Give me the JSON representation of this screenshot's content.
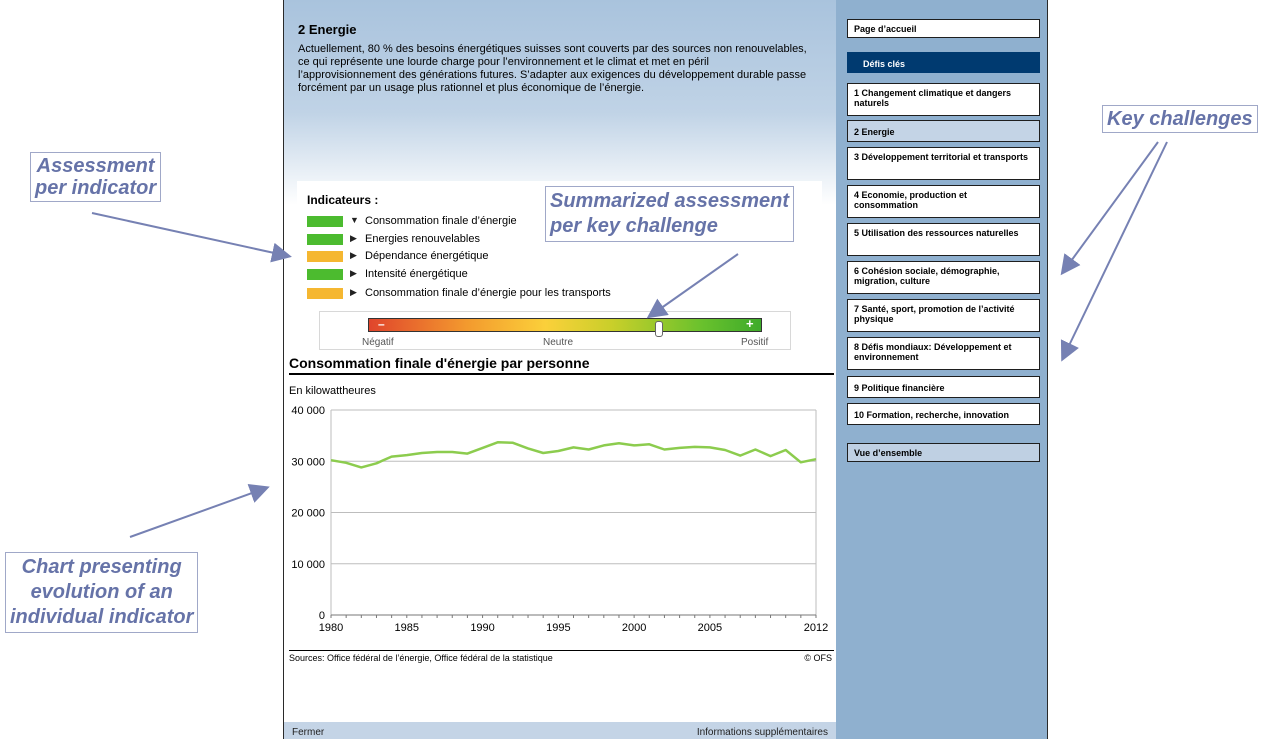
{
  "main": {
    "title": "2 Energie",
    "description": "Actuellement, 80 % des besoins énergétiques suisses sont couverts par des sources non renouvelables, ce qui représente une lourde charge pour l’environnement et le climat et met en péril l’approvisionnement des générations futures. S’adapter aux exigences du développement durable passe forcément par un usage plus rationnel et plus économique de l’énergie.",
    "indicators_title": "Indicateurs :",
    "indicators": [
      {
        "label": "Consommation finale d’énergie",
        "color": "#4cbb2f",
        "arrow": "▼"
      },
      {
        "label": "Energies renouvelables",
        "color": "#4cbb2f",
        "arrow": "▶"
      },
      {
        "label": "Dépendance énergétique",
        "color": "#f5b731",
        "arrow": "▶"
      },
      {
        "label": "Intensité énergétique",
        "color": "#4cbb2f",
        "arrow": "▶"
      },
      {
        "label": "Consommation finale d’énergie pour les transports",
        "color": "#f5b731",
        "arrow": "▶"
      }
    ],
    "scale": {
      "minus": "–",
      "plus": "+",
      "left_label": "Négatif",
      "middle_label": "Neutre",
      "right_label": "Positif",
      "marker_fraction": 0.74
    },
    "chart_title": "Consommation finale d'énergie par personne",
    "unit": "En kilowattheures",
    "sources": "Sources: Office fédéral de l’énergie, Office fédéral de la statistique",
    "copyright": "© OFS"
  },
  "chart_data": {
    "type": "line",
    "title": "Consommation finale d'énergie par personne",
    "ylabel": "En kilowattheures",
    "xlim": [
      1980,
      2012
    ],
    "ylim": [
      0,
      40000
    ],
    "yticks": [
      "0",
      "10 000",
      "20 000",
      "30 000",
      "40 000"
    ],
    "yticks_values": [
      0,
      10000,
      20000,
      30000,
      40000
    ],
    "xticks": [
      1980,
      1985,
      1990,
      1995,
      2000,
      2005,
      2012
    ],
    "grid": true,
    "color": "#8ccc4e",
    "series": [
      {
        "x": [
          1980,
          1981,
          1982,
          1983,
          1984,
          1985,
          1986,
          1987,
          1988,
          1989,
          1990,
          1991,
          1992,
          1993,
          1994,
          1995,
          1996,
          1997,
          1998,
          1999,
          2000,
          2001,
          2002,
          2003,
          2004,
          2005,
          2006,
          2007,
          2008,
          2009,
          2010,
          2011,
          2012
        ],
        "values": [
          30200,
          29700,
          28800,
          29600,
          30900,
          31200,
          31600,
          31800,
          31800,
          31500,
          32600,
          33700,
          33600,
          32500,
          31600,
          32000,
          32700,
          32300,
          33100,
          33500,
          33100,
          33300,
          32300,
          32600,
          32800,
          32700,
          32200,
          31100,
          32300,
          31000,
          32200,
          29800,
          30400
        ]
      }
    ]
  },
  "footer": {
    "close": "Fermer",
    "more": "Informations supplémentaires"
  },
  "sidebar": {
    "home": "Page d’accueil",
    "key_challenges": "Défis clés",
    "items": [
      "1 Changement climatique et dangers naturels",
      "2 Energie",
      "3 Développement territorial et transports",
      "4 Economie, production et consommation",
      "5 Utilisation des ressources naturelles",
      "6 Cohésion sociale, démographie, migration, culture",
      "7 Santé, sport, promotion de l’activité physique",
      "8 Défis mondiaux: Développement et environnement",
      "9 Politique financière",
      "10 Formation, recherche, innovation"
    ],
    "overview": "Vue d’ensemble"
  },
  "annotations": {
    "assessment_line1": "Assessment",
    "assessment_line2": "per indicator",
    "summary_line1": "Summarized assessment",
    "summary_line2": "per key challenge",
    "key_challenges": "Key challenges",
    "chart_line1": "Chart presenting",
    "chart_line2": "evolution of an",
    "chart_line3": "individual indicator"
  }
}
